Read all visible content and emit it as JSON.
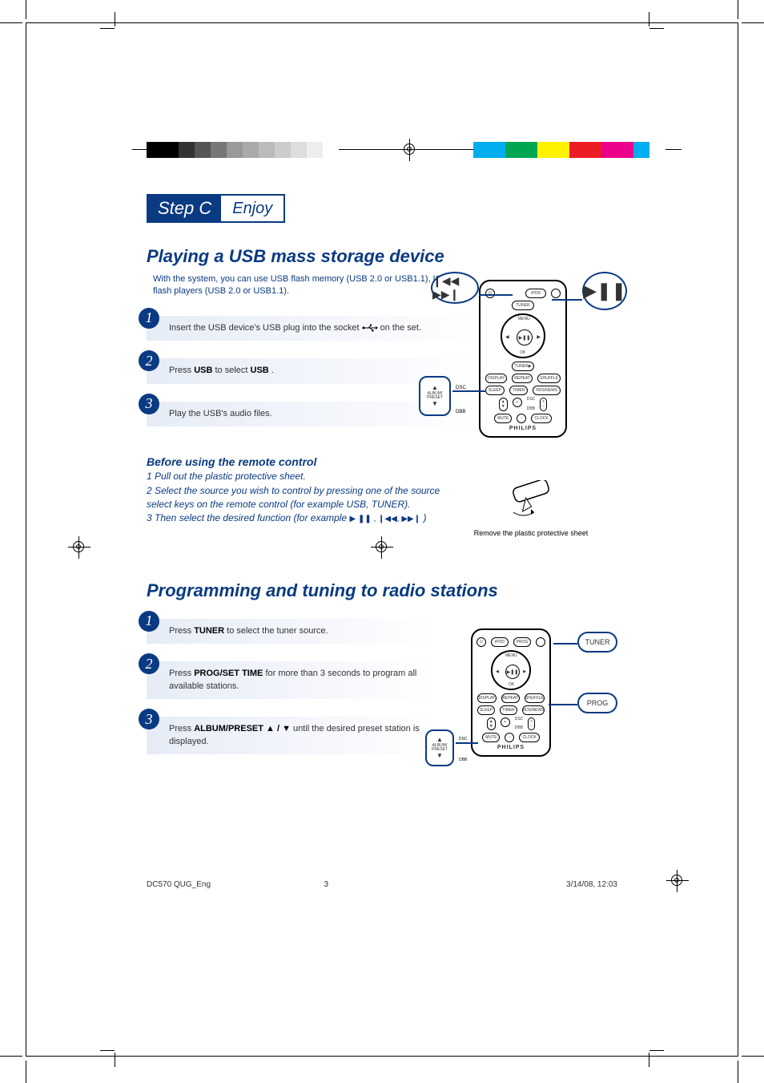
{
  "header": {
    "step_label": "Step C",
    "enjoy_label": "Enjoy"
  },
  "usb_section": {
    "title": "Playing a USB mass storage device",
    "intro": "With the system, you can use USB flash memory (USB 2.0 or USB1.1), USB flash players (USB 2.0 or USB1.1).",
    "step1_pre": "Insert the USB device's USB plug into the socket ",
    "step1_post": " on the set.",
    "step2_pre": "Press ",
    "step2_bold1": "USB",
    "step2_mid": " to select ",
    "step2_bold2": "USB",
    "step2_post": ".",
    "step3": "Play the USB's audio files."
  },
  "remote_section": {
    "title": "Before using the remote control",
    "line1": "1 Pull out the plastic protective sheet.",
    "line2": "2 Select the source you wish to control by pressing one of the source select keys on the remote control (for example USB, TUNER).",
    "line3_pre": "3 Then select the desired function (for example ",
    "line3_post": ")",
    "symbols": "▶ ❚❚ , ❙◀◀, ▶▶❙",
    "caption": "Remove the plastic protective sheet"
  },
  "radio_section": {
    "title": "Programming and tuning to radio stations",
    "step1_pre": "Press ",
    "step1_bold": "TUNER",
    "step1_post": " to select the tuner source.",
    "step2_pre": "Press ",
    "step2_bold": "PROG/SET TIME",
    "step2_post": " for more than 3 seconds to program all available stations.",
    "step3_pre": "Press ",
    "step3_bold": "ALBUM/PRESET ▲ / ▼ ",
    "step3_post": " until the desired preset station is displayed."
  },
  "callouts": {
    "prev_next": "❙◀◀ ▶▶❙",
    "play_pause": "▶❚❚",
    "album_preset_up": "▲",
    "album_preset_label": "ALBUM/\nPRESET",
    "album_preset_down": "▼",
    "dsc": "DSC",
    "dbb": "DBB",
    "tuner": "TUNER",
    "prog": "PROG"
  },
  "remote_buttons": {
    "standby": "⏻",
    "ipod": "iPOD",
    "prog": "PROG",
    "tuner": "TUNER",
    "play": "▶❚❚",
    "prev": "❙◀◀",
    "next": "▶▶❙",
    "menu": "MENU",
    "ok": "OK",
    "disp": "DISPLAY",
    "repeat": "REPEAT",
    "shuffle": "SHUFFLE",
    "sleep": "SLEEP",
    "timer": "TIMER",
    "dsc": "DSC",
    "dbb": "DBB",
    "mute": "MUTE",
    "rds": "RDS/NEWS",
    "plus": "+",
    "minus": "−",
    "brand": "PHILIPS"
  },
  "footer": {
    "doc": "DC570 QUG_Eng",
    "page": "3",
    "date": "3/14/08, 12:03"
  },
  "colorbar": {
    "left": [
      "#000000",
      "#000000",
      "#333333",
      "#555555",
      "#777777",
      "#999999",
      "#aaaaaa",
      "#bbbbbb",
      "#cccccc",
      "#dddddd",
      "#eeeeee",
      "#ffffff"
    ],
    "right": [
      "#00aeef",
      "#00aeef",
      "#00a651",
      "#00a651",
      "#fff200",
      "#fff200",
      "#ed1c24",
      "#ed1c24",
      "#ec008c",
      "#ec008c",
      "#00aeef",
      "#ffffff"
    ]
  }
}
